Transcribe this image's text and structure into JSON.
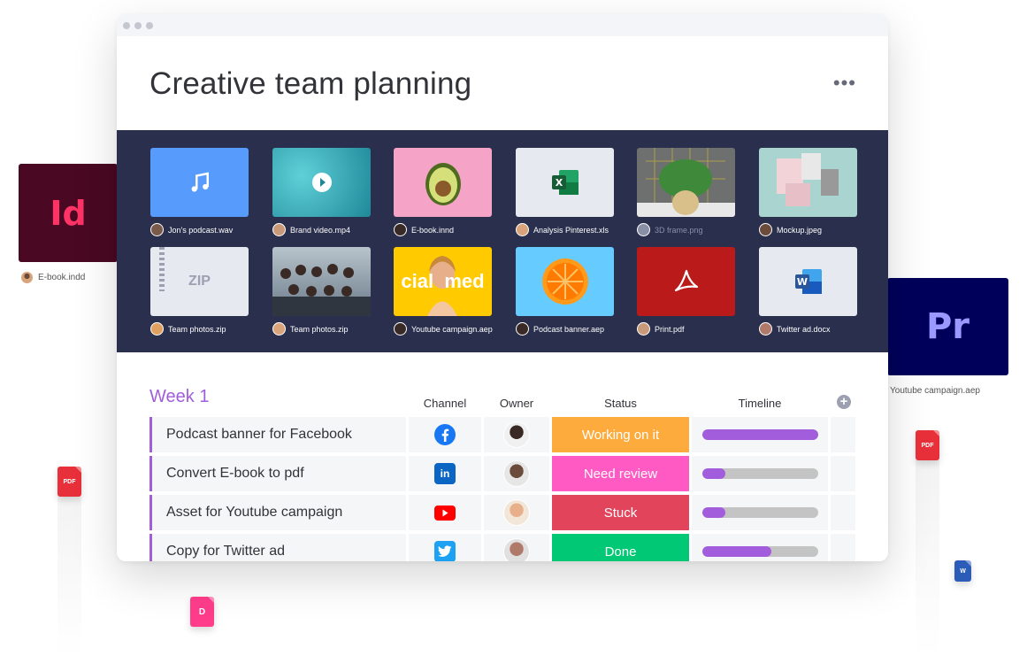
{
  "floating": {
    "indesign_badge": "Id",
    "indesign_file": "E-book.indd",
    "premiere_badge": "Pr",
    "premiere_file": "Youtube campaign.aep",
    "pdf_tag_left": "PDF",
    "pdf_tag_right": "PDF",
    "doc_tag": "D",
    "word_tag": "W"
  },
  "window": {
    "title": "Creative team planning",
    "more_label": "•••"
  },
  "gallery": {
    "files": [
      {
        "name": "Jon's podcast.wav",
        "kind": "audio",
        "color": "#579bfc"
      },
      {
        "name": "Brand video.mp4",
        "kind": "video",
        "color": "#2a9fb0"
      },
      {
        "name": "E-book.innd",
        "kind": "image-avocado",
        "color": "#f5a3c7"
      },
      {
        "name": "Analysis Pinterest.xls",
        "kind": "excel",
        "color": "#e6e9ef"
      },
      {
        "name": "3D frame.png",
        "kind": "image-plant",
        "color": "#6e7070"
      },
      {
        "name": "Mockup.jpeg",
        "kind": "image-mockup",
        "color": "#a9d4cf"
      },
      {
        "name": "Team photos.zip",
        "kind": "zip",
        "color": "#e6e9ef",
        "badge": "ZIP"
      },
      {
        "name": "Team photos.zip",
        "kind": "image-team",
        "color": "#7a8a9a"
      },
      {
        "name": "Youtube campaign.aep",
        "kind": "image-social",
        "color": "#ffcb00",
        "badge": "cial  med"
      },
      {
        "name": "Podcast banner.aep",
        "kind": "image-orange",
        "color": "#66ccff"
      },
      {
        "name": "Print.pdf",
        "kind": "pdf",
        "color": "#bb1a1a"
      },
      {
        "name": "Twitter ad.docx",
        "kind": "word",
        "color": "#e6e9ef"
      }
    ]
  },
  "board": {
    "group_title": "Week 1",
    "columns": {
      "channel": "Channel",
      "owner": "Owner",
      "status": "Status",
      "timeline": "Timeline"
    },
    "add_column": "+",
    "rows": [
      {
        "name": "Podcast banner for Facebook",
        "channel": "facebook",
        "status": "Working on it",
        "status_color": "#fdab3d",
        "progress": 1.0
      },
      {
        "name": "Convert E-book to pdf",
        "channel": "linkedin",
        "status": "Need review",
        "status_color": "#ff5ac4",
        "progress": 0.2
      },
      {
        "name": "Asset for Youtube campaign",
        "channel": "youtube",
        "status": "Stuck",
        "status_color": "#e2445c",
        "progress": 0.2
      },
      {
        "name": "Copy for Twitter ad",
        "channel": "twitter",
        "status": "Done",
        "status_color": "#00c875",
        "progress": 0.6
      }
    ]
  },
  "accent_color": "#a25ddc"
}
